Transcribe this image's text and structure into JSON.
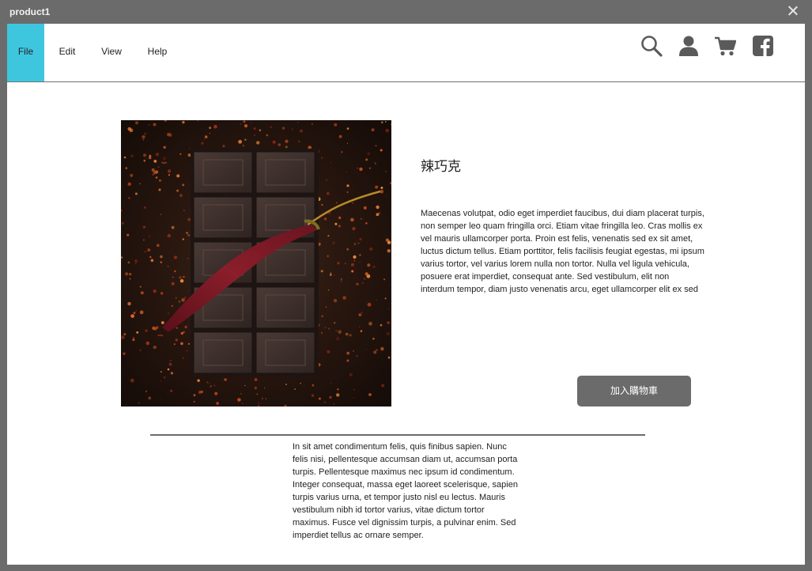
{
  "window": {
    "title": "product1"
  },
  "menu": {
    "items": [
      "File",
      "Edit",
      "View",
      "Help"
    ]
  },
  "toolbar_icons": [
    "search-icon",
    "user-icon",
    "cart-icon",
    "facebook-icon"
  ],
  "colors": {
    "accent": "#3ec6df",
    "button": "#6b6b6b"
  },
  "product": {
    "title": "辣巧克",
    "description": "Maecenas volutpat, odio eget imperdiet faucibus, dui diam placerat turpis, non semper leo quam fringilla orci. Etiam vitae fringilla leo. Cras mollis ex vel mauris ullamcorper porta. Proin est felis, venenatis sed ex sit amet, luctus dictum tellus. Etiam porttitor, felis facilisis feugiat egestas, mi ipsum varius tortor, vel varius lorem nulla non tortor. Nulla vel ligula vehicula, posuere erat imperdiet, consequat ante. Sed vestibulum, elit non interdum tempor, diam justo venenatis arcu, eget ullamcorper elit ex sed",
    "add_to_cart_label": "加入購物車",
    "details": "In sit amet condimentum felis, quis finibus sapien. Nunc felis nisi, pellentesque accumsan diam ut, accumsan porta turpis. Pellentesque maximus nec ipsum id condimentum. Integer consequat, massa eget laoreet scelerisque, sapien turpis varius urna, et tempor justo nisl eu lectus. Mauris vestibulum nibh id tortor varius, vitae dictum tortor maximus. Fusce vel dignissim turpis, a pulvinar enim. Sed imperdiet tellus ac ornare semper."
  }
}
